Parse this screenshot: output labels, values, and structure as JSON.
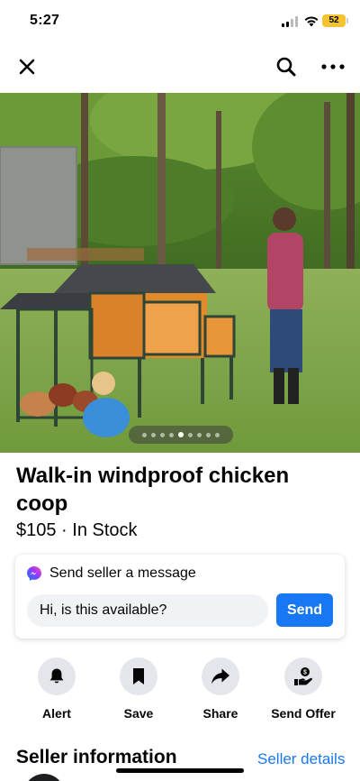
{
  "status_bar": {
    "time": "5:27",
    "battery": "52",
    "battery_color": "#f4c430"
  },
  "nav": {
    "close_icon": "close-icon",
    "search_icon": "search-icon",
    "more_icon": "more-icon"
  },
  "photo": {
    "page_count": 9,
    "active_index": 4
  },
  "listing": {
    "title": "Walk-in windproof chicken coop",
    "price_line": "$105 · In Stock"
  },
  "message": {
    "header": "Send seller a message",
    "input_value": "Hi, is this available?",
    "send_label": "Send",
    "accent": "#1877f2"
  },
  "actions": [
    {
      "label": "Alert",
      "icon": "bell-icon"
    },
    {
      "label": "Save",
      "icon": "bookmark-icon"
    },
    {
      "label": "Share",
      "icon": "share-arrow-icon"
    },
    {
      "label": "Send Offer",
      "icon": "send-offer-icon"
    }
  ],
  "seller": {
    "title": "Seller information",
    "details_link": "Seller details"
  }
}
